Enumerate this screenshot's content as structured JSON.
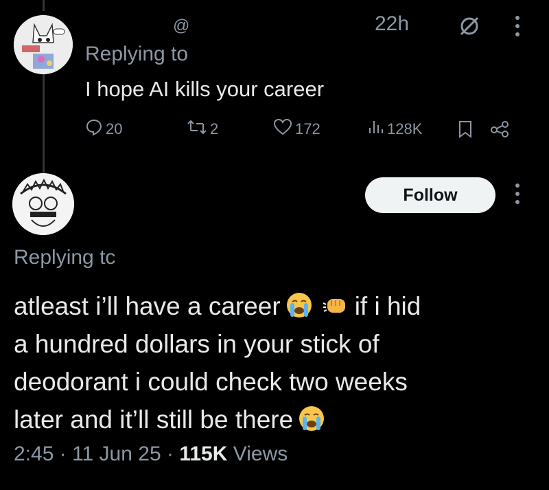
{
  "tweet1": {
    "mention": "@",
    "time": "22h",
    "replying_label": "Replying to",
    "text": "I hope AI kills your career",
    "actions": {
      "replies": "20",
      "retweets": "2",
      "likes": "172",
      "views": "128K"
    }
  },
  "tweet2": {
    "follow_label": "Follow",
    "replying_label": "Replying tc",
    "text_parts": {
      "p1": "atleast i’ll have a career",
      "p2": "if i hid",
      "p3": "a hundred dollars in your stick of",
      "p4": "deodorant i could check two weeks",
      "p5": "later and it’ll still be there"
    },
    "meta": {
      "time": "2:45",
      "date": "11 Jun 25",
      "views_count": "115K",
      "views_label": "Views"
    }
  },
  "icons": [
    "reply-icon",
    "retweet-icon",
    "like-icon",
    "views-icon",
    "bookmark-icon",
    "share-icon",
    "more-icon",
    "grok-icon",
    "crying-emoji",
    "fist-emoji"
  ],
  "colors": {
    "background": "#000000",
    "text": "#e7e9ea",
    "muted": "#8b98a5",
    "follow_bg": "#eff3f4"
  }
}
